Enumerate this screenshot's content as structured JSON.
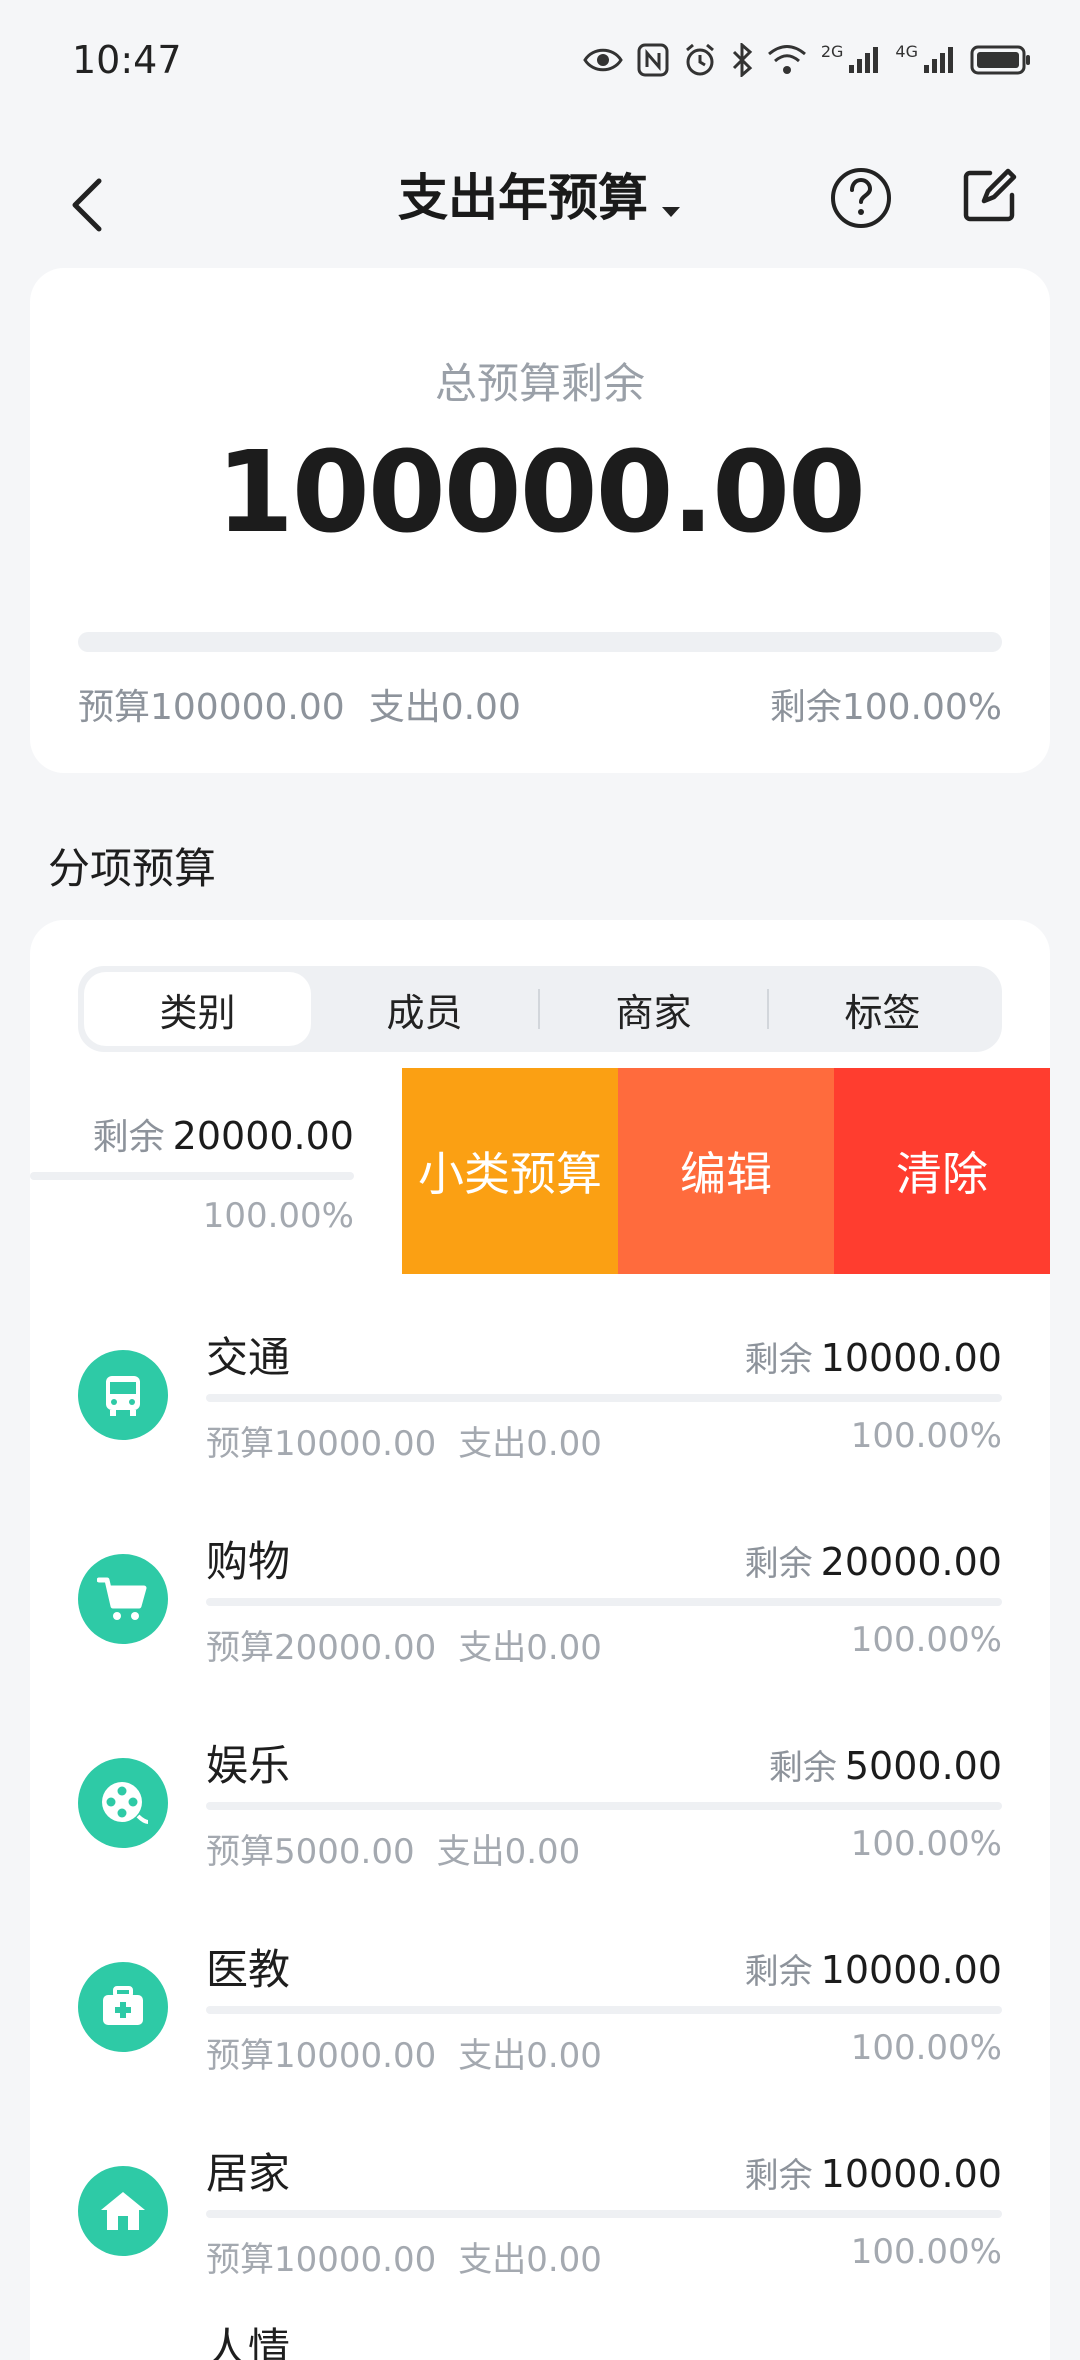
{
  "status": {
    "time": "10:47",
    "net1": "2G",
    "net2": "4G"
  },
  "header": {
    "title": "支出年预算"
  },
  "summary": {
    "label": "总预算剩余",
    "amount": "100000.00",
    "budget": "预算100000.00",
    "spent": "支出0.00",
    "remain_pct": "剩余100.00%",
    "progress": 0
  },
  "section": {
    "title": "分项预算"
  },
  "tabs": [
    "类别",
    "成员",
    "商家",
    "标签"
  ],
  "swiped_row": {
    "remain_label": "剩余",
    "remain_value": "20000.00",
    "pct": "100.00%",
    "actions": [
      "小类预算",
      "编辑",
      "清除"
    ]
  },
  "categories": [
    {
      "name": "交通",
      "icon": "bus-icon",
      "remain_label": "剩余",
      "remain": "10000.00",
      "budget": "预算10000.00",
      "spent": "支出0.00",
      "pct": "100.00%"
    },
    {
      "name": "购物",
      "icon": "cart-icon",
      "remain_label": "剩余",
      "remain": "20000.00",
      "budget": "预算20000.00",
      "spent": "支出0.00",
      "pct": "100.00%"
    },
    {
      "name": "娱乐",
      "icon": "film-reel-icon",
      "remain_label": "剩余",
      "remain": "5000.00",
      "budget": "预算5000.00",
      "spent": "支出0.00",
      "pct": "100.00%"
    },
    {
      "name": "医教",
      "icon": "medical-kit-icon",
      "remain_label": "剩余",
      "remain": "10000.00",
      "budget": "预算10000.00",
      "spent": "支出0.00",
      "pct": "100.00%"
    },
    {
      "name": "居家",
      "icon": "home-icon",
      "remain_label": "剩余",
      "remain": "10000.00",
      "budget": "预算10000.00",
      "spent": "支出0.00",
      "pct": "100.00%"
    }
  ],
  "partial_item": {
    "name": "人情"
  },
  "colors": {
    "accent": "#2ecaa6",
    "action_sub": "#fba013",
    "action_edit": "#ff6b3d",
    "action_clear": "#ff3d2f"
  }
}
